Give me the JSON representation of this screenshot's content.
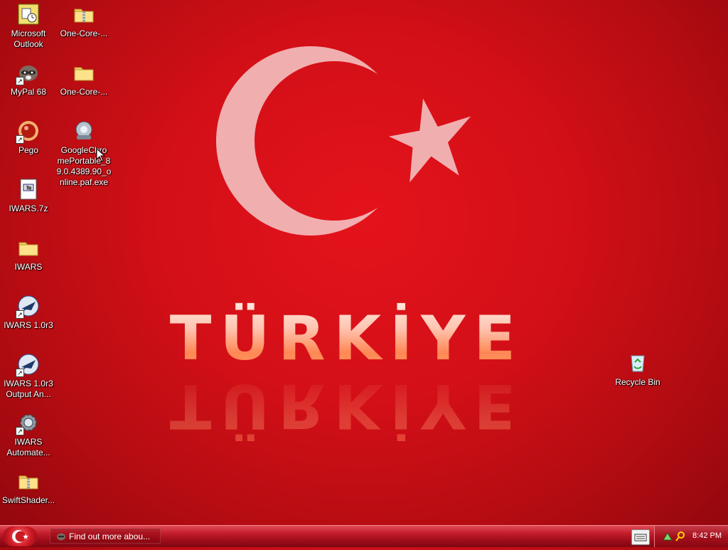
{
  "wallpaper": {
    "word": "TÜRKİYE",
    "colors": {
      "background": "#d30f17",
      "crescent": "#f7d1d1",
      "star": "#f7d1d1"
    }
  },
  "desktop_icons_left_col1": [
    {
      "label": "Microsoft Outlook",
      "icon": "outlook-icon"
    },
    {
      "label": "MyPal 68",
      "icon": "raccoon-icon",
      "shortcut": true
    },
    {
      "label": "Pego",
      "icon": "red-ball-icon",
      "shortcut": true
    },
    {
      "label": "IWARS.7z",
      "icon": "archive-file-icon"
    },
    {
      "label": "IWARS",
      "icon": "folder-icon"
    },
    {
      "label": "IWARS 1.0r3",
      "icon": "jet-icon",
      "shortcut": true
    },
    {
      "label": "IWARS 1.0r3 Output An...",
      "icon": "jet-icon",
      "shortcut": true
    },
    {
      "label": "IWARS Automate...",
      "icon": "gear-icon",
      "shortcut": true
    },
    {
      "label": "SwiftShader...",
      "icon": "zip-folder-icon"
    }
  ],
  "desktop_icons_left_col2": [
    {
      "label": "One-Core-...",
      "icon": "zip-folder-icon"
    },
    {
      "label": "One-Core-...",
      "icon": "folder-icon"
    },
    {
      "label": "GoogleChromePortable_89.0.4389.90_online.paf.exe",
      "label_lines": [
        "GoogleChro",
        "mePortable_8",
        "9.0.4389.90_o",
        "nline.paf.exe"
      ],
      "icon": "installer-icon"
    }
  ],
  "desktop_icons_right": [
    {
      "label": "Recycle Bin",
      "icon": "recycle-bin-icon"
    }
  ],
  "taskbar": {
    "start_icon": "crescent-start-icon",
    "notification": "Find out more abou...",
    "clock": "8:42 PM",
    "tray_icons": [
      "keyboard-icon",
      "network-icon",
      "search-icon"
    ]
  }
}
